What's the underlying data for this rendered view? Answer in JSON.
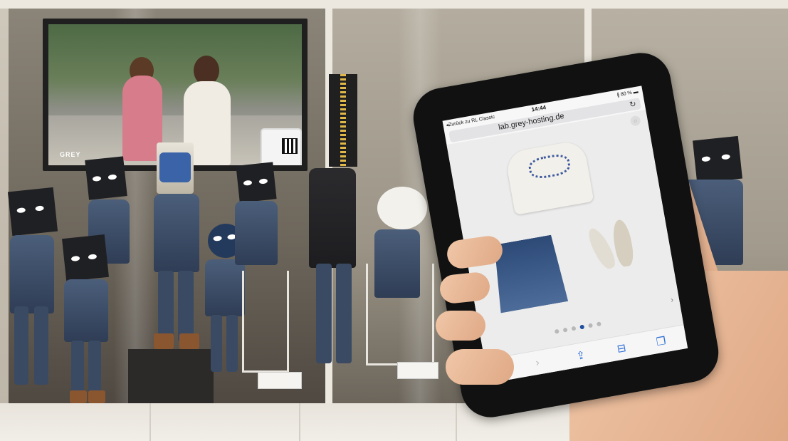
{
  "tv": {
    "logo": "GREY"
  },
  "phone": {
    "status_back": "◂Zurück zu RL Classic",
    "status_time": "14:44",
    "status_battery": "∦ 80 % ▬",
    "url": "lab.grey-hosting.de",
    "carousel": {
      "total": 5,
      "active_index": 3
    },
    "toolbar_icons": [
      "back-icon",
      "forward-icon",
      "share-icon",
      "bookmarks-icon",
      "tabs-icon"
    ]
  },
  "colors": {
    "accent": "#2d6fd6",
    "dot_active": "#1f4f9e"
  }
}
